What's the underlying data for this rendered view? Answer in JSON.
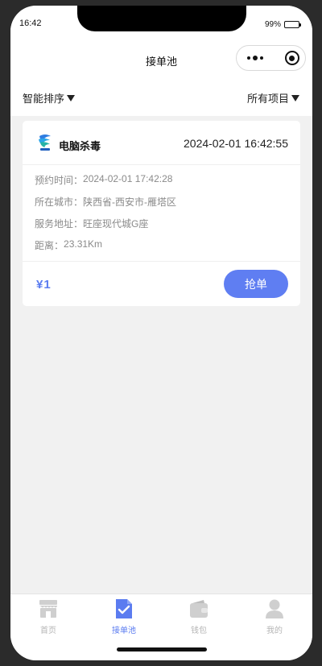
{
  "status_bar": {
    "time": "16:42",
    "battery": "99%"
  },
  "nav": {
    "title": "接单池"
  },
  "filters": {
    "sort_label": "智能排序",
    "project_label": "所有项目"
  },
  "order": {
    "service_name": "电脑杀毒",
    "created_time": "2024-02-01 16:42:55",
    "appointment_label": "预约时间：",
    "appointment_value": "2024-02-01 17:42:28",
    "city_label": "所在城市：",
    "city_value": "陕西省-西安市-雁塔区",
    "address_label": "服务地址：",
    "address_value": "旺座现代城G座",
    "distance_label": "距离：",
    "distance_value": "23.31Km",
    "price": "¥1",
    "grab_label": "抢单"
  },
  "tabs": [
    {
      "label": "首页",
      "icon": "shop-icon",
      "active": false
    },
    {
      "label": "接单池",
      "icon": "document-check-icon",
      "active": true
    },
    {
      "label": "钱包",
      "icon": "wallet-icon",
      "active": false
    },
    {
      "label": "我的",
      "icon": "user-icon",
      "active": false
    }
  ],
  "colors": {
    "accent": "#5b7cf0",
    "button": "#5f7ef2",
    "inactive_tab": "#cfcfcf"
  }
}
